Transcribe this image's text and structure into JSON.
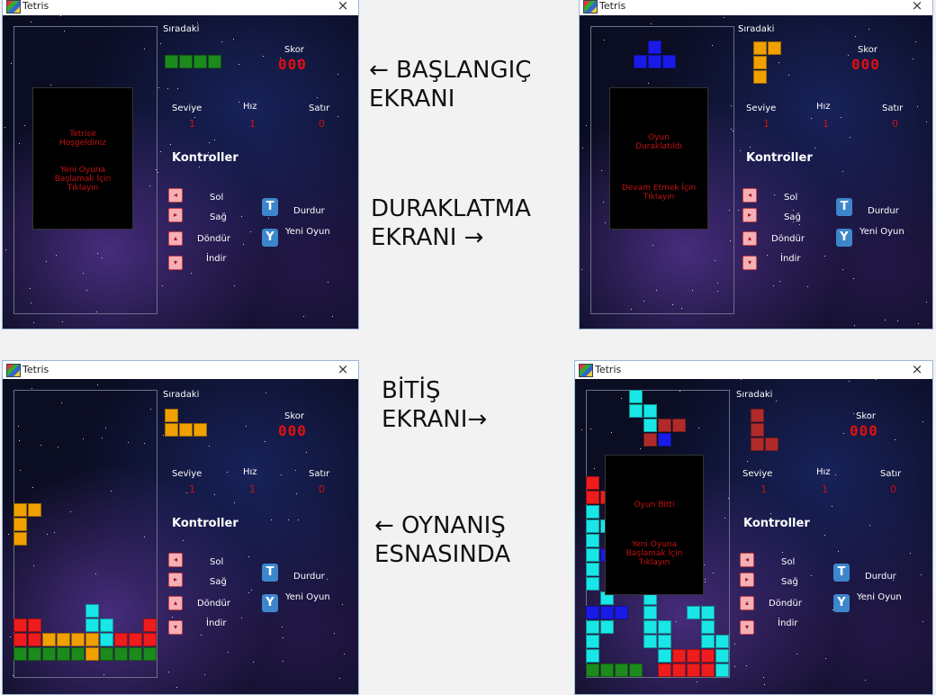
{
  "window_title": "Tetris",
  "close_glyph": "×",
  "labels": {
    "next": "Sıradaki",
    "score": "Skor",
    "level": "Seviye",
    "speed": "Hız",
    "lines": "Satır",
    "controls": "Kontroller",
    "left": "Sol",
    "right": "Sağ",
    "rotate": "Döndür",
    "drop": "İndir",
    "pause": "Durdur",
    "newgame": "Yeni Oyun",
    "key_pause": "T",
    "key_newgame": "Y",
    "key_left": "◂",
    "key_right": "▸",
    "key_rotate": "▴",
    "key_drop": "▾"
  },
  "stats": {
    "score": "000",
    "level": "1",
    "speed": "1",
    "lines": "0"
  },
  "screens": {
    "start": {
      "overlay": [
        "Tetrise Hoşgeldiniz",
        "Yeni Oyuna Başlamak İçin Tıklayın"
      ]
    },
    "pause": {
      "overlay": [
        "Oyun Duraklatıldı",
        "Devam Etmek İçin Tıklayın"
      ]
    },
    "end": {
      "overlay": [
        "Oyun Bitti",
        "Yeni Oyuna Başlamak İçin Tıklayın"
      ]
    }
  },
  "captions": {
    "start": "← BAŞLANGIÇ\nEKRANI",
    "pause": "DURAKLATMA\nEKRANI →",
    "end": "BİTİŞ\nEKRANI→",
    "play": "← OYNANIŞ\nESNASINDA"
  },
  "colors": {
    "green": "#1c8a1c",
    "blue": "#1a1ae6",
    "orange": "#f0a000",
    "red": "#ee1c1c",
    "cyan": "#19e6e6",
    "darkred": "#b02a2a"
  }
}
